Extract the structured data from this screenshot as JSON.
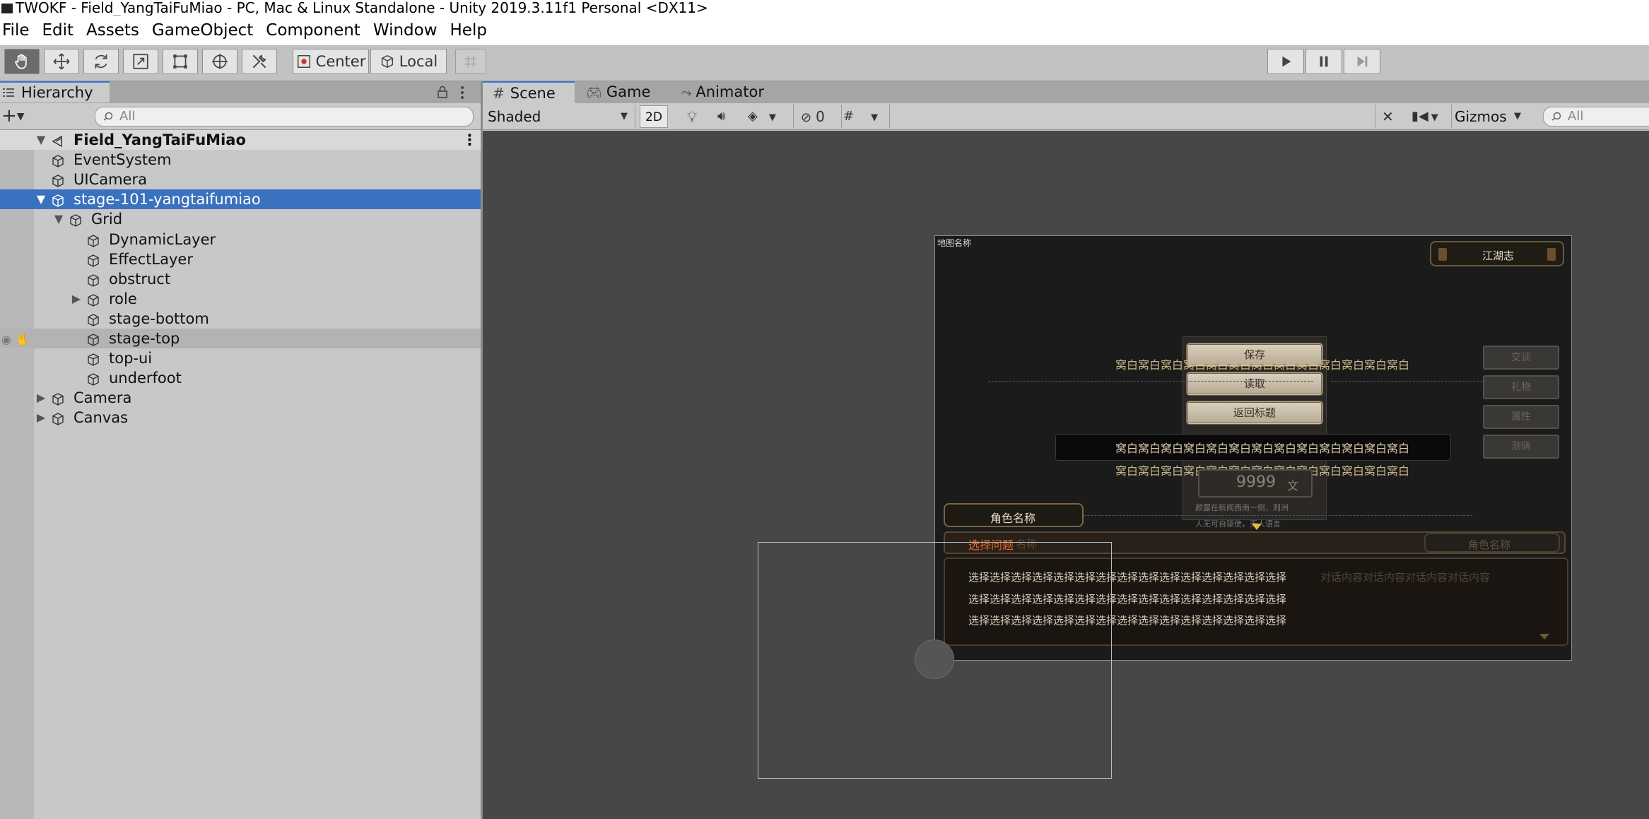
{
  "window": {
    "title": "TWOKF - Field_YangTaiFuMiao - PC, Mac & Linux Standalone - Unity 2019.3.11f1 Personal <DX11>"
  },
  "menu": [
    "File",
    "Edit",
    "Assets",
    "GameObject",
    "Component",
    "Window",
    "Help"
  ],
  "toolbar": {
    "tools": [
      "hand-icon",
      "move-icon",
      "rotate-icon",
      "scale-icon",
      "rect-icon",
      "transform-icon",
      "custom-tools-icon"
    ],
    "pivot_label": "Center",
    "space_label": "Local",
    "play": [
      "play-icon",
      "pause-icon",
      "step-icon"
    ]
  },
  "hierarchy": {
    "tab": "Hierarchy",
    "search_placeholder": "All",
    "rows": [
      {
        "label": "Field_YangTaiFuMiao",
        "depth": 0,
        "fold": "open",
        "kind": "scene"
      },
      {
        "label": "EventSystem",
        "depth": 1,
        "fold": "none"
      },
      {
        "label": "UICamera",
        "depth": 1,
        "fold": "none"
      },
      {
        "label": "stage-101-yangtaifumiao",
        "depth": 1,
        "fold": "open",
        "selected": true
      },
      {
        "label": "Grid",
        "depth": 2,
        "fold": "open"
      },
      {
        "label": "DynamicLayer",
        "depth": 3,
        "fold": "none"
      },
      {
        "label": "EffectLayer",
        "depth": 3,
        "fold": "none"
      },
      {
        "label": "obstruct",
        "depth": 3,
        "fold": "none"
      },
      {
        "label": "role",
        "depth": 3,
        "fold": "closed"
      },
      {
        "label": "stage-bottom",
        "depth": 3,
        "fold": "none"
      },
      {
        "label": "stage-top",
        "depth": 3,
        "fold": "none",
        "hover": true
      },
      {
        "label": "top-ui",
        "depth": 3,
        "fold": "none"
      },
      {
        "label": "underfoot",
        "depth": 3,
        "fold": "none"
      },
      {
        "label": "Camera",
        "depth": 1,
        "fold": "closed"
      },
      {
        "label": "Canvas",
        "depth": 1,
        "fold": "closed"
      }
    ]
  },
  "scene_tabs": [
    {
      "label": "Scene",
      "icon": "grid-icon"
    },
    {
      "label": "Game",
      "icon": "gamepad-icon"
    },
    {
      "label": "Animator",
      "icon": "animator-icon"
    }
  ],
  "scene_toolbar": {
    "shading": "Shaded",
    "mode_2d": "2D",
    "hidden_count": "0",
    "gizmos": "Gizmos",
    "search_placeholder": "All"
  },
  "game_ui": {
    "map_name": "地图名称",
    "journal": "江湖志",
    "menu_buttons": [
      "保存",
      "读取",
      "返回标题"
    ],
    "side_buttons": [
      "交谈",
      "礼物",
      "属性",
      "测俩"
    ],
    "subtitle_lines": [
      "窝白窝白窝白窝白窝白窝白窝白窝白窝白窝白窝白窝白窝白",
      "窝白窝白窝白窝白窝白窝白窝白窝白窝白窝白窝白窝白窝白",
      "窝白窝白窝白窝白窝白窝白窝白窝白窝白窝白窝白窝白窝白"
    ],
    "money": "9999",
    "money_unit": "文",
    "hint_lines": [
      "颜露在新闻西南一侧，则洲",
      "人无可自驱使，无人语言"
    ],
    "role_name": "角色名称",
    "role_name_right": "角色名称",
    "role_name_ghost": "名称",
    "question_label": "选择问题",
    "choice_lines": [
      "选择选择选择选择选择选择选择选择选择选择选择选择选择选择选择",
      "选择选择选择选择选择选择选择选择选择选择选择选择选择选择选择",
      "选择选择选择选择选择选择选择选择选择选择选择选择选择选择选择"
    ],
    "dialog_text": "对话内容对话内容对话内容对话内容"
  },
  "colors": {
    "selection": "#3a72c0",
    "scene_bg": "#474747",
    "accent_tab": "#3a79d6",
    "question_orange": "#e06a2a",
    "gold_text": "#c9b48a"
  }
}
